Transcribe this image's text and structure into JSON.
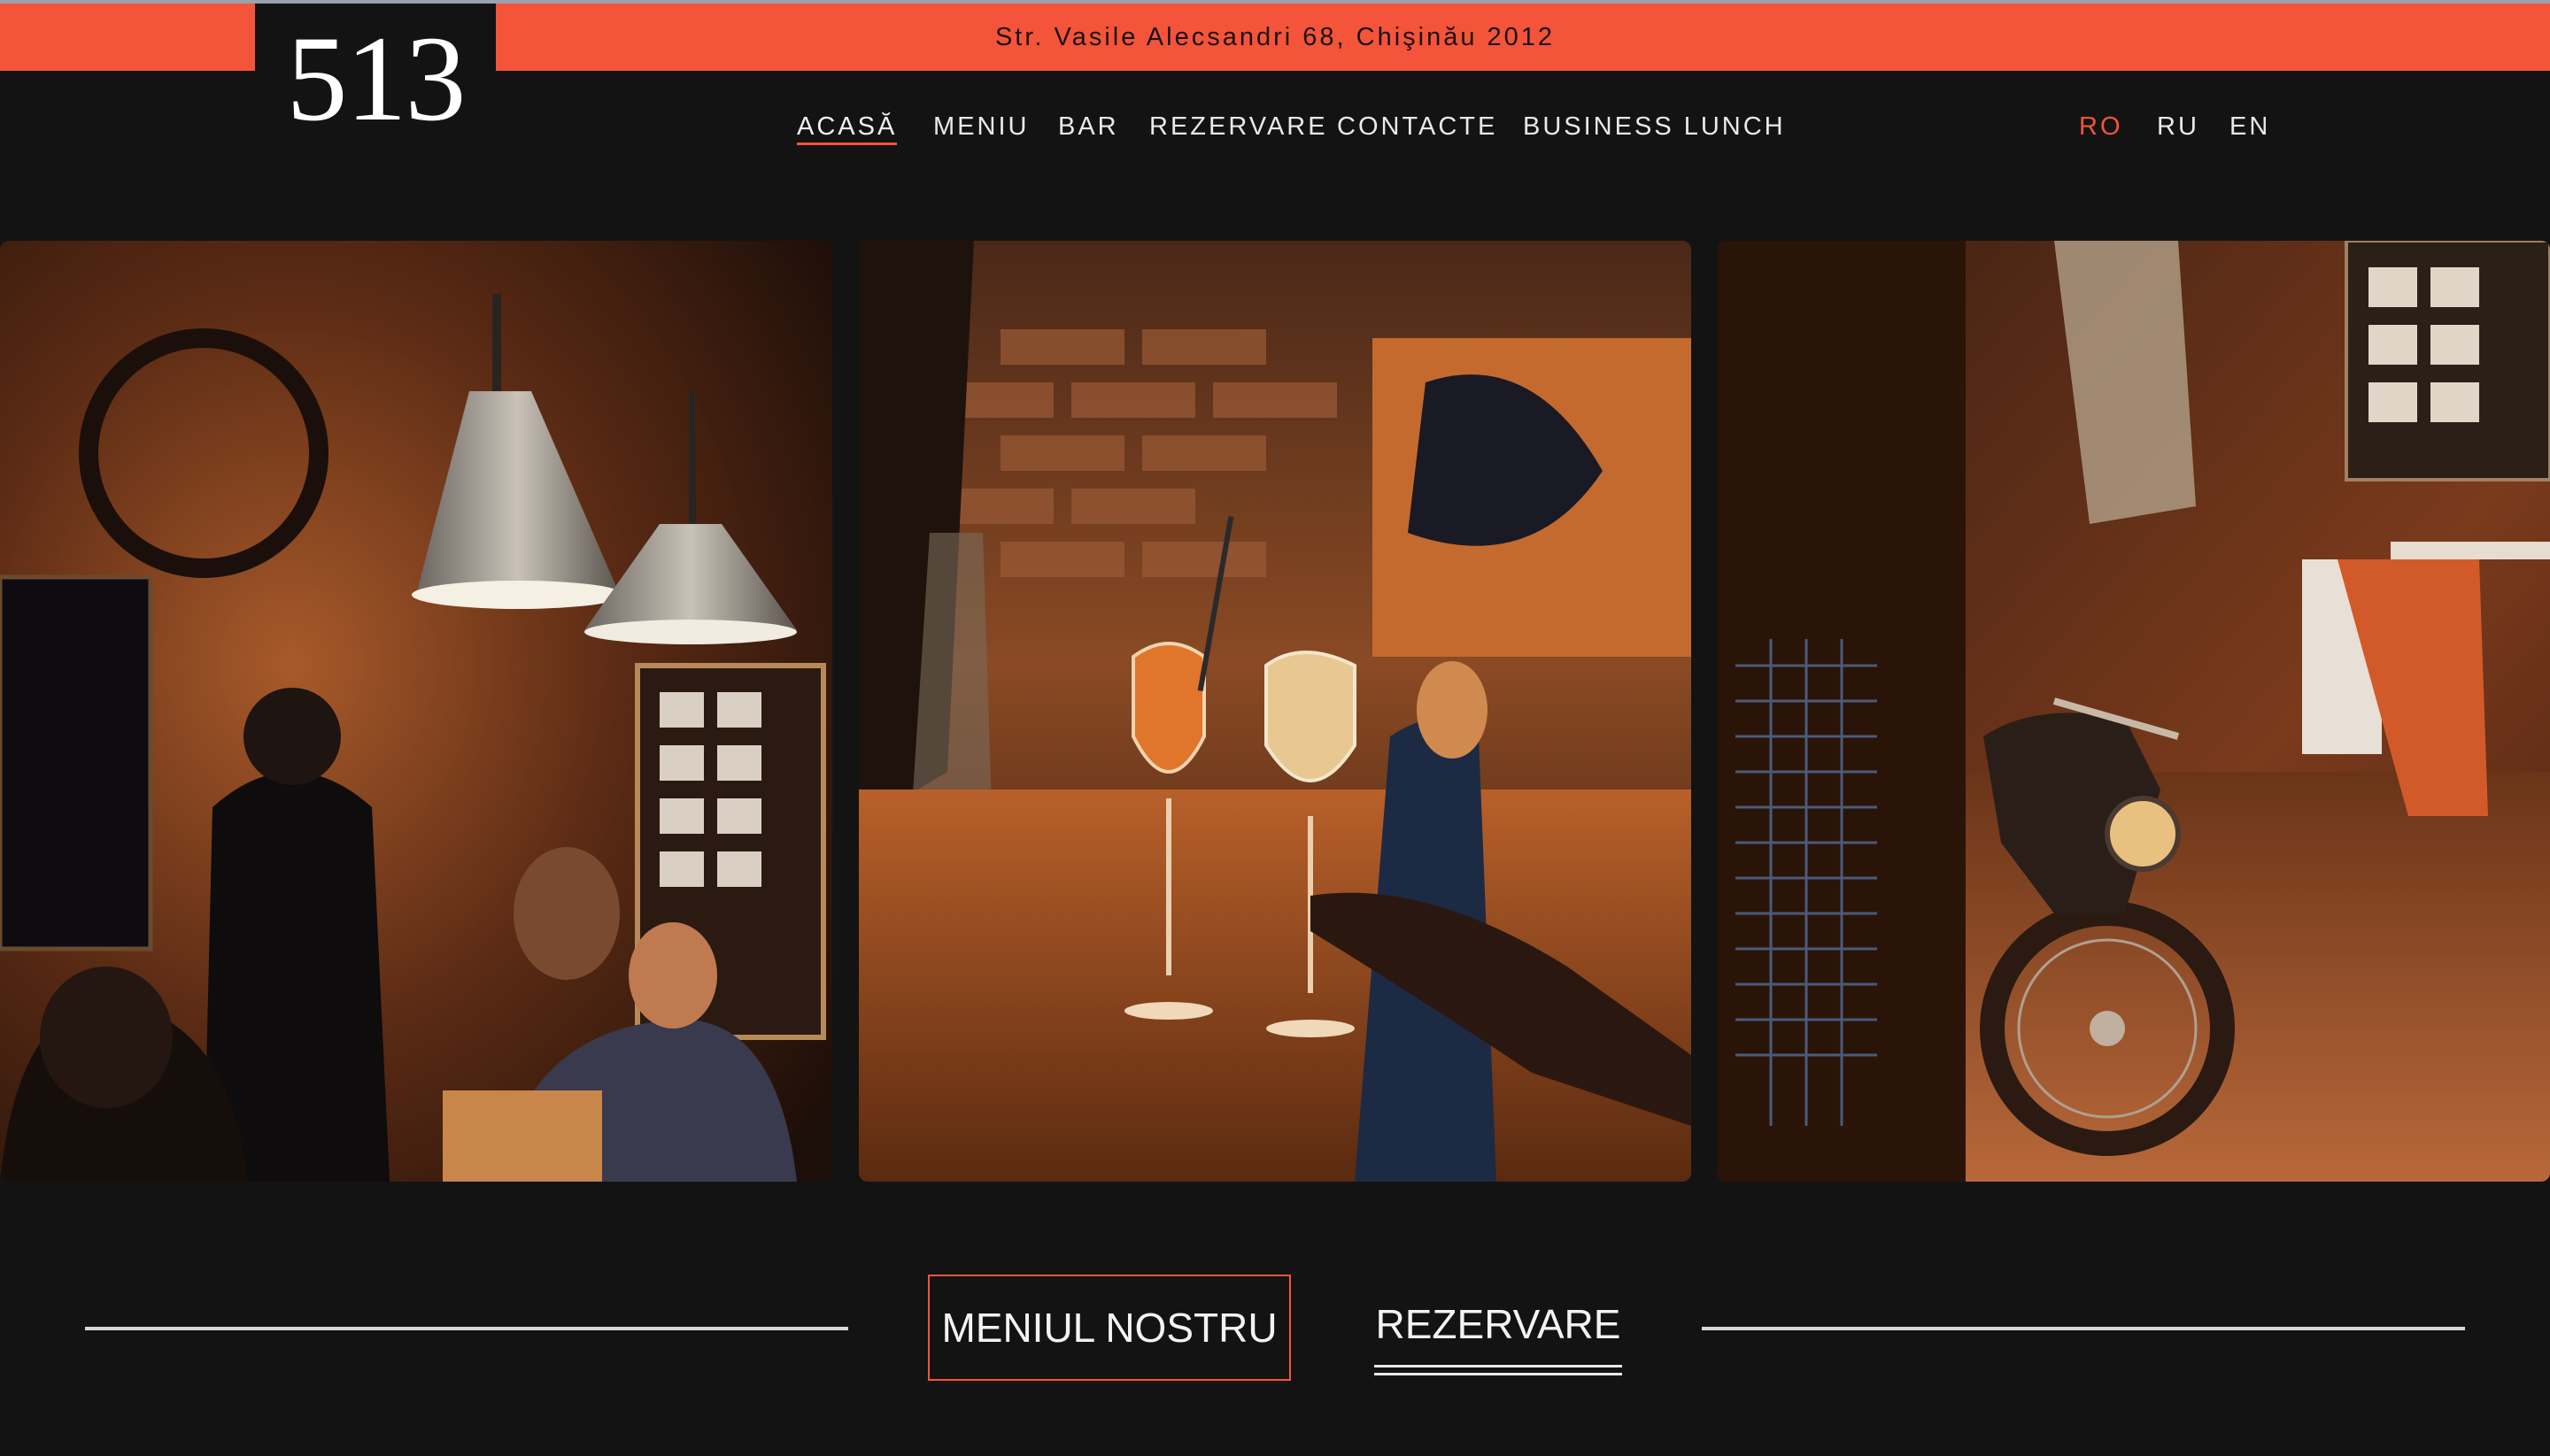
{
  "topbar": {
    "address": "Str. Vasile Alecsandri 68, Chişinău 2012"
  },
  "logo": {
    "text": "513"
  },
  "nav": {
    "items": [
      {
        "label": "ACASĂ",
        "active": true
      },
      {
        "label": "MENIU"
      },
      {
        "label": "BAR"
      },
      {
        "label": "REZERVARE"
      },
      {
        "label": "CONTACTE"
      },
      {
        "label": "BUSINESS LUNCH"
      }
    ]
  },
  "languages": {
    "items": [
      {
        "label": "RO",
        "selected": true
      },
      {
        "label": "RU"
      },
      {
        "label": "EN"
      }
    ]
  },
  "gallery": {
    "photos": [
      {
        "name": "restaurant-dining-photo"
      },
      {
        "name": "cocktail-glasses-photo"
      },
      {
        "name": "motorcycle-interior-photo"
      }
    ]
  },
  "actions": {
    "menu_label": "MENIUL NOSTRU",
    "reserve_label": "REZERVARE"
  },
  "colors": {
    "accent": "#f4543a",
    "background": "#131313"
  }
}
